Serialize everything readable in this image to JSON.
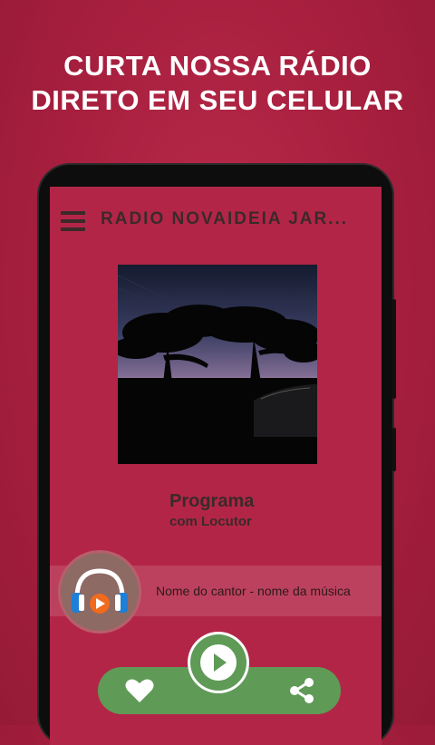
{
  "promo": {
    "line1": "CURTA NOSSA RÁDIO",
    "line2": "DIRETO EM SEU CELULAR"
  },
  "app": {
    "title": "RADIO NOVAIDEIA JAR..."
  },
  "program": {
    "name": "Programa",
    "host": "com Locutor"
  },
  "now_playing": {
    "text": "Nome do cantor - nome da música"
  },
  "colors": {
    "background": "#a71f3e",
    "screen": "#b32547",
    "accent_green": "#5f9a57",
    "text_dark": "#3a2a2a"
  },
  "icons": {
    "menu": "hamburger-menu-icon",
    "logo": "headphones-play-icon",
    "play": "play-icon",
    "heart": "heart-icon",
    "share": "share-icon"
  }
}
